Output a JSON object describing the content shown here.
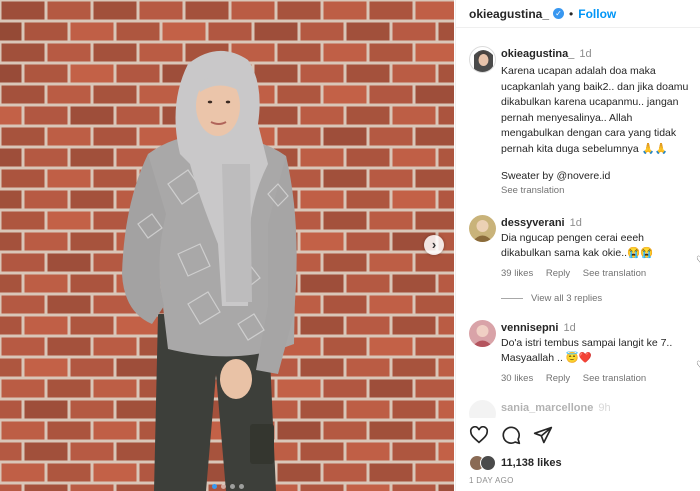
{
  "post": {
    "username": "okieagustina_",
    "follow_label": "Follow",
    "dot": "•",
    "slide_count": 4,
    "active_slide": 1
  },
  "caption": {
    "username": "okieagustina_",
    "time": "1d",
    "text": "Karena ucapan adalah doa maka ucapkanlah yang baik2.. dan jika doamu dikabulkan karena ucapanmu.. jangan pernah menyesalinya.. Allah mengabulkan dengan cara yang tidak pernah kita duga sebelumnya 🙏🙏",
    "credit": "Sweater by @novere.id",
    "see_translation": "See translation"
  },
  "comments": [
    {
      "username": "dessyverani",
      "time": "1d",
      "text": "Dia ngucap pengen cerai eeeh dikabulkan sama kak okie..😭😭",
      "likes": "39 likes",
      "reply": "Reply",
      "see_translation": "See translation",
      "avatar_color": "#c9b37a"
    },
    {
      "username": "vennisepni",
      "time": "1d",
      "text": "Do'a istri tembus sampai langit ke 7.. Masyaallah .. 😇❤️",
      "likes": "30 likes",
      "reply": "Reply",
      "see_translation": "See translation",
      "avatar_color": "#d9a3a8"
    },
    {
      "username": "sania_marcellone",
      "time": "9h"
    }
  ],
  "view_replies": "View all 3 replies",
  "footer": {
    "likes": "11,138 likes",
    "date": "1 DAY AGO"
  },
  "colors": {
    "brick": "#b85a43",
    "mortar": "#d9c6b8",
    "link_blue": "#0095f6"
  },
  "icons": [
    "verified-badge-icon",
    "heart-icon",
    "comment-icon",
    "share-icon",
    "chevron-right-icon"
  ]
}
